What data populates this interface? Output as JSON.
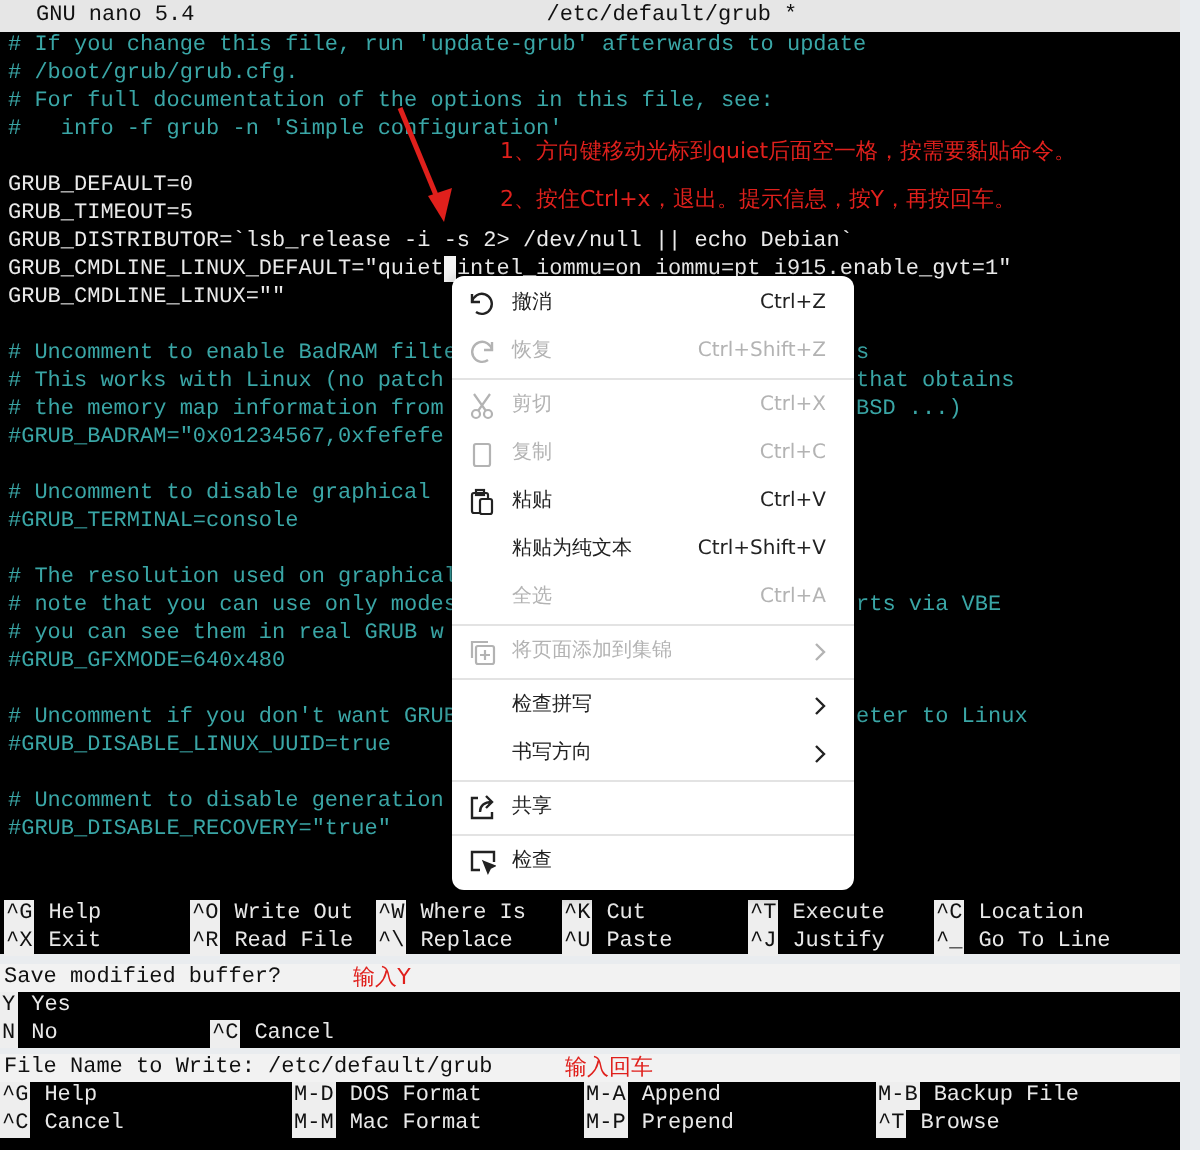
{
  "editor": {
    "app": "GNU nano 5.4",
    "file": "/etc/default/grub *",
    "lines": [
      {
        "kind": "comment",
        "text": "# If you change this file, run 'update-grub' afterwards to update"
      },
      {
        "kind": "comment",
        "text": "# /boot/grub/grub.cfg."
      },
      {
        "kind": "comment",
        "text": "# For full documentation of the options in this file, see:"
      },
      {
        "kind": "comment",
        "text": "#   info -f grub -n 'Simple configuration'"
      },
      {
        "kind": "blank"
      },
      {
        "kind": "code",
        "text": "GRUB_DEFAULT=0"
      },
      {
        "kind": "code",
        "text": "GRUB_TIMEOUT=5"
      },
      {
        "kind": "code",
        "text": "GRUB_DISTRIBUTOR=`lsb_release -i -s 2> /dev/null || echo Debian`"
      },
      {
        "kind": "code",
        "text": "GRUB_CMDLINE_LINUX_DEFAULT=\"quiet",
        "cursor": true,
        "rest": "intel_iommu=on iommu=pt i915.enable_gvt=1\""
      },
      {
        "kind": "code",
        "text": "GRUB_CMDLINE_LINUX=\"\""
      },
      {
        "kind": "blank"
      },
      {
        "kind": "comment",
        "text": "# Uncomment to enable BadRAM filte",
        "right": "s"
      },
      {
        "kind": "comment",
        "text": "# This works with Linux (no patch",
        "right": "that obtains"
      },
      {
        "kind": "comment",
        "text": "# the memory map information from",
        "right": "BSD ...)"
      },
      {
        "kind": "comment",
        "text": "#GRUB_BADRAM=\"0x01234567,0xfefefe"
      },
      {
        "kind": "blank"
      },
      {
        "kind": "comment",
        "text": "# Uncomment to disable graphical"
      },
      {
        "kind": "comment",
        "text": "#GRUB_TERMINAL=console"
      },
      {
        "kind": "blank"
      },
      {
        "kind": "comment",
        "text": "# The resolution used on graphical"
      },
      {
        "kind": "comment",
        "text": "# note that you can use only modes",
        "right": "rts via VBE"
      },
      {
        "kind": "comment",
        "text": "# you can see them in real GRUB w"
      },
      {
        "kind": "comment",
        "text": "#GRUB_GFXMODE=640x480"
      },
      {
        "kind": "blank"
      },
      {
        "kind": "comment",
        "text": "# Uncomment if you don't want GRUB",
        "right": "eter to Linux"
      },
      {
        "kind": "comment",
        "text": "#GRUB_DISABLE_LINUX_UUID=true"
      },
      {
        "kind": "blank"
      },
      {
        "kind": "comment",
        "text": "# Uncomment to disable generation"
      },
      {
        "kind": "comment",
        "text": "#GRUB_DISABLE_RECOVERY=\"true\""
      },
      {
        "kind": "blank"
      },
      {
        "kind": "blank"
      }
    ],
    "shortcuts": [
      [
        {
          "key": "^G",
          "label": "Help"
        },
        {
          "key": "^O",
          "label": "Write Out"
        },
        {
          "key": "^W",
          "label": "Where Is"
        },
        {
          "key": "^K",
          "label": "Cut"
        },
        {
          "key": "^T",
          "label": "Execute"
        },
        {
          "key": "^C",
          "label": "Location"
        }
      ],
      [
        {
          "key": "^X",
          "label": "Exit"
        },
        {
          "key": "^R",
          "label": "Read File"
        },
        {
          "key": "^\\",
          "label": "Replace"
        },
        {
          "key": "^U",
          "label": "Paste"
        },
        {
          "key": "^J",
          "label": "Justify"
        },
        {
          "key": "^_",
          "label": "Go To Line"
        }
      ]
    ]
  },
  "notes": [
    "1、方向键移动光标到quiet后面空一格，按需要黏贴命令。",
    "2、按住Ctrl+x，退出。提示信息，按Y，再按回车。"
  ],
  "context_menu": {
    "items": [
      {
        "kind": "item",
        "label": "撤消",
        "shortcut": "Ctrl+Z",
        "disabled": false
      },
      {
        "kind": "item",
        "label": "恢复",
        "shortcut": "Ctrl+Shift+Z",
        "disabled": true
      },
      {
        "kind": "separator"
      },
      {
        "kind": "item",
        "label": "剪切",
        "shortcut": "Ctrl+X",
        "disabled": true
      },
      {
        "kind": "item",
        "label": "复制",
        "shortcut": "Ctrl+C",
        "disabled": true
      },
      {
        "kind": "item",
        "label": "粘贴",
        "shortcut": "Ctrl+V",
        "disabled": false
      },
      {
        "kind": "item",
        "label": "粘贴为纯文本",
        "shortcut": "Ctrl+Shift+V",
        "disabled": false
      },
      {
        "kind": "item",
        "label": "全选",
        "shortcut": "Ctrl+A",
        "disabled": true
      },
      {
        "kind": "separator"
      },
      {
        "kind": "item",
        "label": "将页面添加到集锦",
        "disabled": true,
        "submenu": true
      },
      {
        "kind": "separator"
      },
      {
        "kind": "item",
        "label": "检查拼写",
        "disabled": false,
        "submenu": true
      },
      {
        "kind": "item",
        "label": "书写方向",
        "disabled": false,
        "submenu": true
      },
      {
        "kind": "separator"
      },
      {
        "kind": "item",
        "label": "共享",
        "disabled": false
      },
      {
        "kind": "separator"
      },
      {
        "kind": "item",
        "label": "检查",
        "disabled": false
      }
    ]
  },
  "save_prompt": {
    "question": "Save modified buffer?",
    "note": "输入Y",
    "rows": [
      [
        {
          "key": "Y",
          "label": "Yes"
        }
      ],
      [
        {
          "key": "N",
          "label": "No"
        },
        {
          "key": "^C",
          "label": "Cancel"
        }
      ]
    ]
  },
  "write_prompt": {
    "question": "File Name to Write: /etc/default/grub",
    "note": "输入回车",
    "rows": [
      [
        {
          "key": "^G",
          "label": "Help"
        },
        {
          "key": "M-D",
          "label": "DOS Format"
        },
        {
          "key": "M-A",
          "label": "Append"
        },
        {
          "key": "M-B",
          "label": "Backup File"
        }
      ],
      [
        {
          "key": "^C",
          "label": "Cancel"
        },
        {
          "key": "M-M",
          "label": "Mac Format"
        },
        {
          "key": "M-P",
          "label": "Prepend"
        },
        {
          "key": "^T",
          "label": "Browse"
        }
      ]
    ]
  }
}
